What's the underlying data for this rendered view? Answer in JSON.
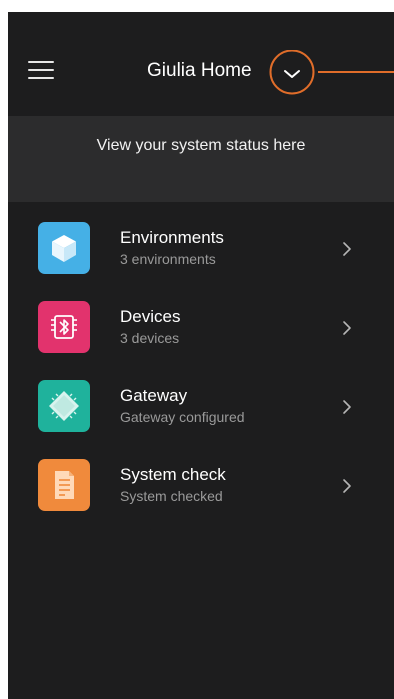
{
  "header": {
    "title": "Giulia Home",
    "callout_color": "#e06d2a"
  },
  "status": {
    "text": "View your system status here"
  },
  "items": [
    {
      "label": "Environments",
      "subtitle": "3 environments",
      "icon": "cube-icon",
      "color": "#45b0e6"
    },
    {
      "label": "Devices",
      "subtitle": "3 devices",
      "icon": "bluetooth-device-icon",
      "color": "#e2336d"
    },
    {
      "label": "Gateway",
      "subtitle": "Gateway configured",
      "icon": "chip-icon",
      "color": "#1fb29c"
    },
    {
      "label": "System check",
      "subtitle": "System checked",
      "icon": "document-icon",
      "color": "#f08a3c"
    }
  ]
}
